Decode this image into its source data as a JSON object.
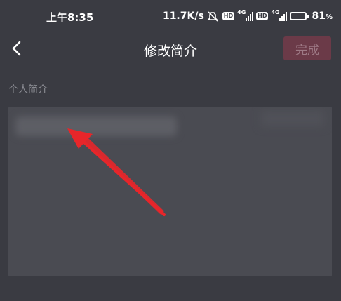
{
  "status_bar": {
    "time": "上午8:35",
    "net_speed": "11.7K/s",
    "hd1": "HD",
    "sig1_label": "4G",
    "hd2": "HD",
    "sig2_label": "4G",
    "battery_percent": "81",
    "battery_level": 0.81,
    "icons": [
      "mute-icon",
      "signal-icon",
      "signal-icon",
      "battery-icon"
    ]
  },
  "header": {
    "title": "修改简介",
    "done_label": "完成",
    "back_icon": "chevron-left-icon"
  },
  "form": {
    "section_label": "个人简介",
    "bio_value": ""
  },
  "annotation": {
    "arrow_icon": "red-arrow-icon",
    "color": "#e8262a"
  }
}
